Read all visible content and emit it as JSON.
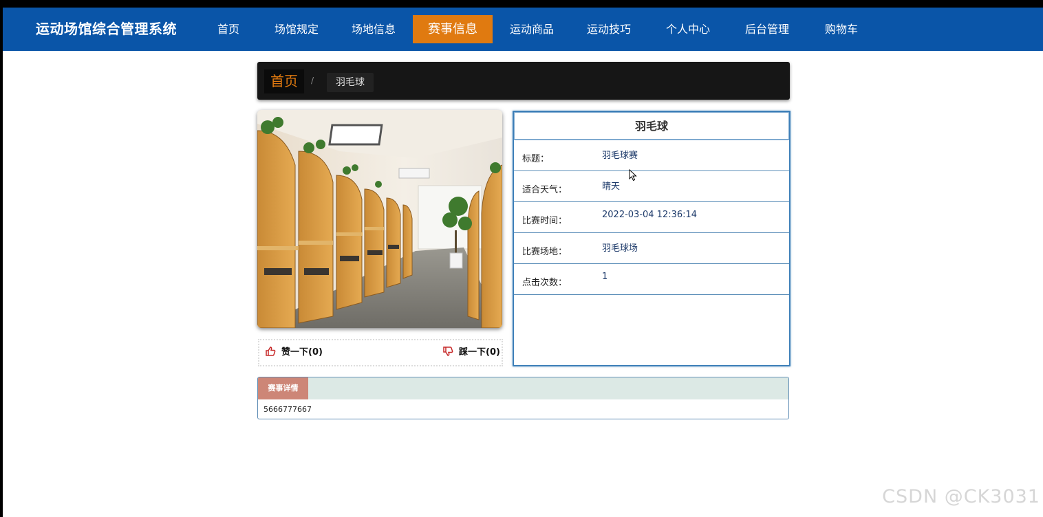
{
  "header": {
    "brand": "运动场馆综合管理系统",
    "nav": [
      {
        "label": "首页",
        "active": false
      },
      {
        "label": "场馆规定",
        "active": false
      },
      {
        "label": "场地信息",
        "active": false
      },
      {
        "label": "赛事信息",
        "active": true
      },
      {
        "label": "运动商品",
        "active": false
      },
      {
        "label": "运动技巧",
        "active": false
      },
      {
        "label": "个人中心",
        "active": false
      },
      {
        "label": "后台管理",
        "active": false
      },
      {
        "label": "购物车",
        "active": false
      }
    ]
  },
  "breadcrumb": {
    "home": "首页",
    "separator": "/",
    "current": "羽毛球"
  },
  "votes": {
    "like_label": "赞一下(0)",
    "dislike_label": "踩一下(0)"
  },
  "info": {
    "title": "羽毛球",
    "rows": [
      {
        "label": "标题：",
        "value": "羽毛球赛"
      },
      {
        "label": "适合天气：",
        "value": "晴天"
      },
      {
        "label": "比赛时间：",
        "value": "2022-03-04 12:36:14"
      },
      {
        "label": "比赛场地：",
        "value": "羽毛球场"
      },
      {
        "label": "点击次数：",
        "value": "1"
      }
    ]
  },
  "detail": {
    "tab": "赛事详情",
    "content": "5666777667"
  },
  "watermark": "CSDN @CK3031",
  "colors": {
    "nav_bg": "#0a55a8",
    "nav_active": "#e07a10",
    "panel_border": "#3d7fb8",
    "detail_tab": "#cd8677"
  },
  "icons": [
    "thumbs-up-icon",
    "thumbs-down-icon",
    "mouse-cursor-icon"
  ]
}
